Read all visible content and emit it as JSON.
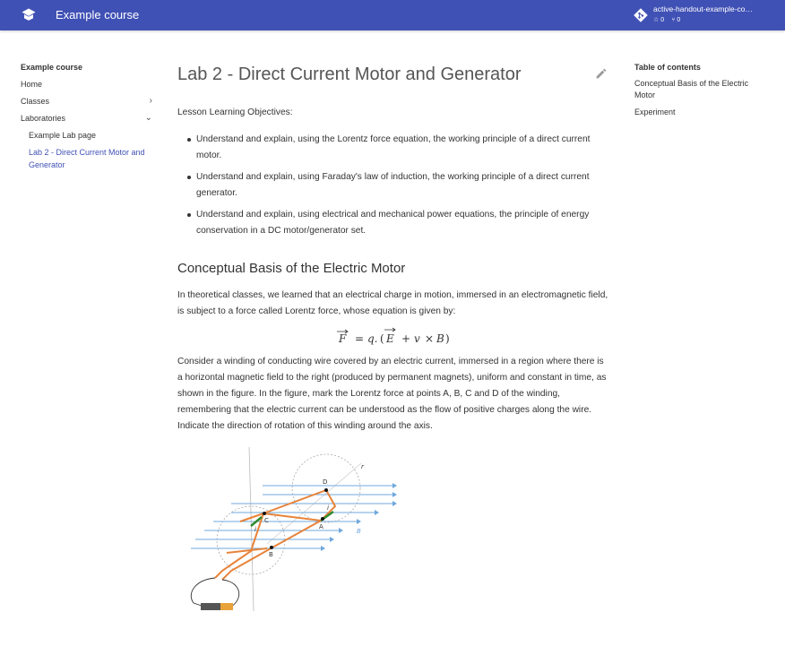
{
  "header": {
    "site_title": "Example course",
    "repo_name": "active-handout-example-co…",
    "stars": "0",
    "forks": "0"
  },
  "nav": {
    "title": "Example course",
    "items": [
      {
        "label": "Home"
      },
      {
        "label": "Classes"
      },
      {
        "label": "Laboratories"
      }
    ],
    "sub_items": [
      {
        "label": "Example Lab page"
      },
      {
        "label": "Lab 2 - Direct Current Motor and Generator"
      }
    ]
  },
  "toc": {
    "title": "Table of contents",
    "items": [
      {
        "label": "Conceptual Basis of the Electric Motor"
      },
      {
        "label": "Experiment"
      }
    ]
  },
  "page": {
    "title": "Lab 2 - Direct Current Motor and Generator",
    "objectives_intro": "Lesson Learning Objectives:",
    "objectives": [
      "Understand and explain, using the Lorentz force equation, the working principle of a direct current motor.",
      "Understand and explain, using Faraday's law of induction, the working principle of a direct current generator.",
      "Understand and explain, using electrical and mechanical power equations, the principle of energy conservation in a DC motor/generator set."
    ],
    "section_title": "Conceptual Basis of the Electric Motor",
    "para1": "In theoretical classes, we learned that an electrical charge in motion, immersed in an electromagnetic field, is subject to a force called Lorentz force, whose equation is given by:",
    "para2": "Consider a winding of conducting wire covered by an electric current, immersed in a region where there is a horizontal magnetic field to the right (produced by permanent magnets), uniform and constant in time, as shown in the figure. In the figure, mark the Lorentz force at points A, B, C and D of the winding, remembering that the electric current can be understood as the flow of positive charges along the wire. Indicate the direction of rotation of this winding around the axis.",
    "equation": {
      "F": "F",
      "eq": "=",
      "q": "q.",
      "paren_open": "(",
      "E": "E",
      "plus": "+",
      "v": "v",
      "times": "×",
      "B": "B",
      "paren_close": ")"
    },
    "figure_labels": {
      "D": "D",
      "A": "A",
      "B": "B",
      "C": "C",
      "i1": "i",
      "i2": "i",
      "r": "r",
      "Bvec": "B"
    }
  },
  "colors": {
    "primary": "#4051b5",
    "wire": "#e8833a",
    "field": "#6fa8dc",
    "current": "#2e8b2e"
  }
}
